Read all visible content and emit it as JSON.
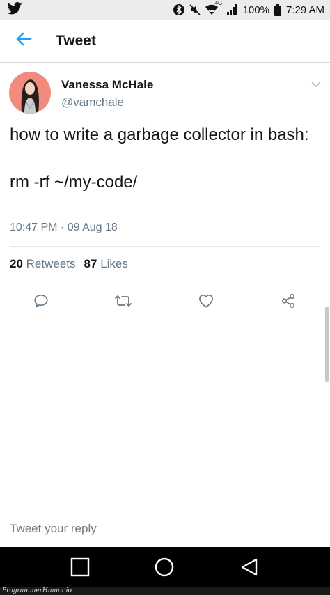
{
  "status_bar": {
    "network_label": "4G",
    "battery": "100%",
    "time": "7:29 AM",
    "icons": [
      "twitter-bird-icon",
      "bluetooth-icon",
      "mute-icon",
      "wifi-icon",
      "signal-icon",
      "battery-icon"
    ]
  },
  "header": {
    "title": "Tweet",
    "back_icon": "arrow-left-icon"
  },
  "tweet": {
    "author": {
      "display_name": "Vanessa McHale",
      "handle": "@vamchale"
    },
    "text": "how to write a garbage collector in bash:\n\nrm -rf ~/my-code/",
    "timestamp": "10:47 PM · 09 Aug 18",
    "stats": {
      "retweets_count": "20",
      "retweets_label": "Retweets",
      "likes_count": "87",
      "likes_label": "Likes"
    },
    "actions": [
      "reply-icon",
      "retweet-icon",
      "like-icon",
      "share-icon"
    ]
  },
  "reply": {
    "placeholder": "Tweet your reply"
  },
  "nav_bar": [
    "recent-apps-icon",
    "home-icon",
    "back-icon"
  ],
  "watermark": "ProgrammerHumor.io",
  "colors": {
    "accent": "#1da1f2",
    "secondary_text": "#657786",
    "primary_text": "#14171a",
    "avatar_bg": "#f08b7e"
  }
}
